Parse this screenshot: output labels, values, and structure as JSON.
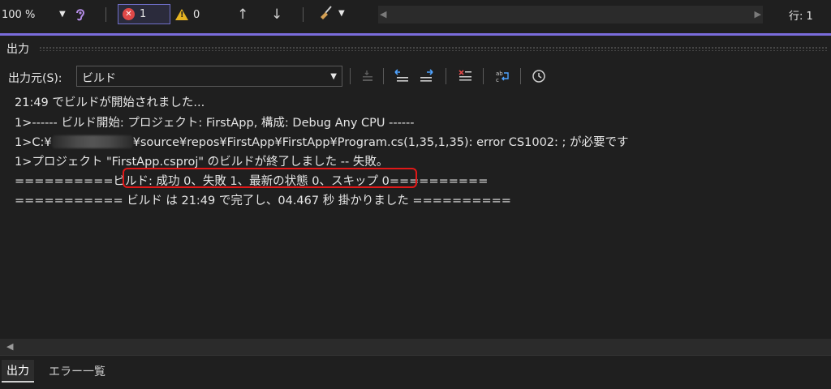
{
  "toolbar": {
    "zoom_value": "100 %",
    "error_count": "1",
    "warning_count": "0",
    "line_indicator": "行: 1"
  },
  "output_pane": {
    "title": "出力",
    "source_label": "出力元(S):",
    "source_value": "ビルド",
    "lines": [
      "21:49 でビルドが開始されました...",
      "1>------ ビルド開始: プロジェクト: FirstApp, 構成: Debug Any CPU ------",
      "1>C:¥",
      "¥source¥repos¥FirstApp¥FirstApp¥Program.cs(1,35,1,35): error CS1002: ; が必要です",
      "1>プロジェクト \"FirstApp.csproj\" のビルドが終了しました -- 失敗。",
      "==========",
      "ビルド: 成功 0、失敗 1、最新の状態 0、スキップ 0",
      "==========",
      "=========== ビルド は 21:49 で完了し、04.467 秒 掛かりました =========="
    ]
  },
  "tabs": [
    {
      "label": "出力",
      "active": true
    },
    {
      "label": "エラー一覧",
      "active": false
    }
  ],
  "colors": {
    "accent": "#7a6cdc",
    "error": "#e04848",
    "warning": "#e6b422",
    "highlight_border": "#e01818"
  }
}
